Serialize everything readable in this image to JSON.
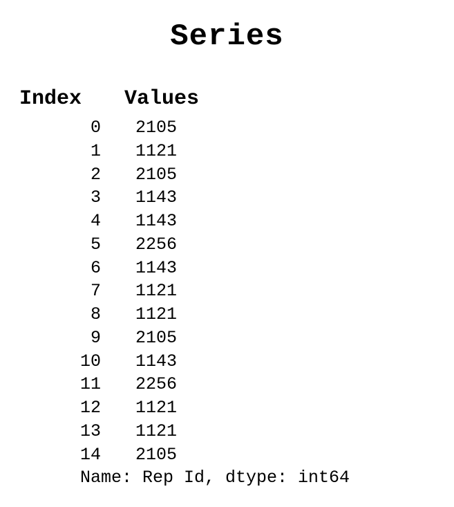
{
  "title": "Series",
  "headers": {
    "index": "Index",
    "values": "Values"
  },
  "rows": [
    {
      "index": "0",
      "value": "2105"
    },
    {
      "index": "1",
      "value": "1121"
    },
    {
      "index": "2",
      "value": "2105"
    },
    {
      "index": "3",
      "value": "1143"
    },
    {
      "index": "4",
      "value": "1143"
    },
    {
      "index": "5",
      "value": "2256"
    },
    {
      "index": "6",
      "value": "1143"
    },
    {
      "index": "7",
      "value": "1121"
    },
    {
      "index": "8",
      "value": "1121"
    },
    {
      "index": "9",
      "value": "2105"
    },
    {
      "index": "10",
      "value": "1143"
    },
    {
      "index": "11",
      "value": "2256"
    },
    {
      "index": "12",
      "value": "1121"
    },
    {
      "index": "13",
      "value": "1121"
    },
    {
      "index": "14",
      "value": "2105"
    }
  ],
  "footer": "Name: Rep Id, dtype: int64"
}
